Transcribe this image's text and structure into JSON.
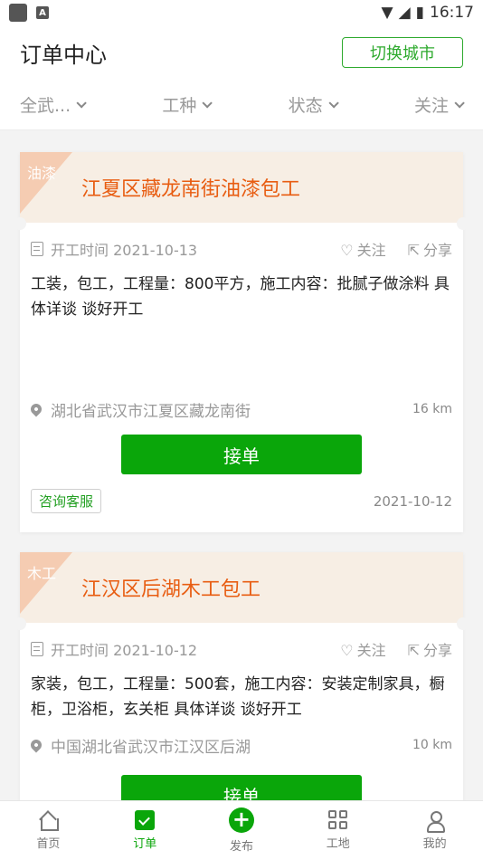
{
  "status_bar": {
    "time": "16:17",
    "a_icon": "A"
  },
  "header": {
    "title": "订单中心",
    "city_button": "切换城市"
  },
  "filters": [
    {
      "label": "全武..."
    },
    {
      "label": "工种"
    },
    {
      "label": "状态"
    },
    {
      "label": "关注"
    }
  ],
  "orders": [
    {
      "tag": "油漆",
      "title": "江夏区藏龙南街油漆包工",
      "start_label": "开工时间 2021-10-13",
      "follow": "关注",
      "share": "分享",
      "description": "工装，包工，工程量：800平方，施工内容：批腻子做涂料 具体详谈 谈好开工",
      "location": "湖北省武汉市江夏区藏龙南街",
      "distance": "16 km",
      "accept": "接单",
      "service": "咨询客服",
      "posted": "2021-10-12"
    },
    {
      "tag": "木工",
      "title": "江汉区后湖木工包工",
      "start_label": "开工时间 2021-10-12",
      "follow": "关注",
      "share": "分享",
      "description": "家装，包工，工程量：500套，施工内容：安装定制家具，橱柜，卫浴柜，玄关柜 具体详谈 谈好开工",
      "location": "中国湖北省武汉市江汉区后湖",
      "distance": "10 km",
      "accept": "接单"
    }
  ],
  "tabs": [
    {
      "label": "首页",
      "icon": "home-icon"
    },
    {
      "label": "订单",
      "icon": "order-icon"
    },
    {
      "label": "发布",
      "icon": "plus-icon"
    },
    {
      "label": "工地",
      "icon": "grid-icon"
    },
    {
      "label": "我的",
      "icon": "user-icon"
    }
  ],
  "colors": {
    "accent": "#0aa60a",
    "title": "#e85d12",
    "tag_bg": "#f5ccb2",
    "head_bg": "#f7eee4"
  }
}
